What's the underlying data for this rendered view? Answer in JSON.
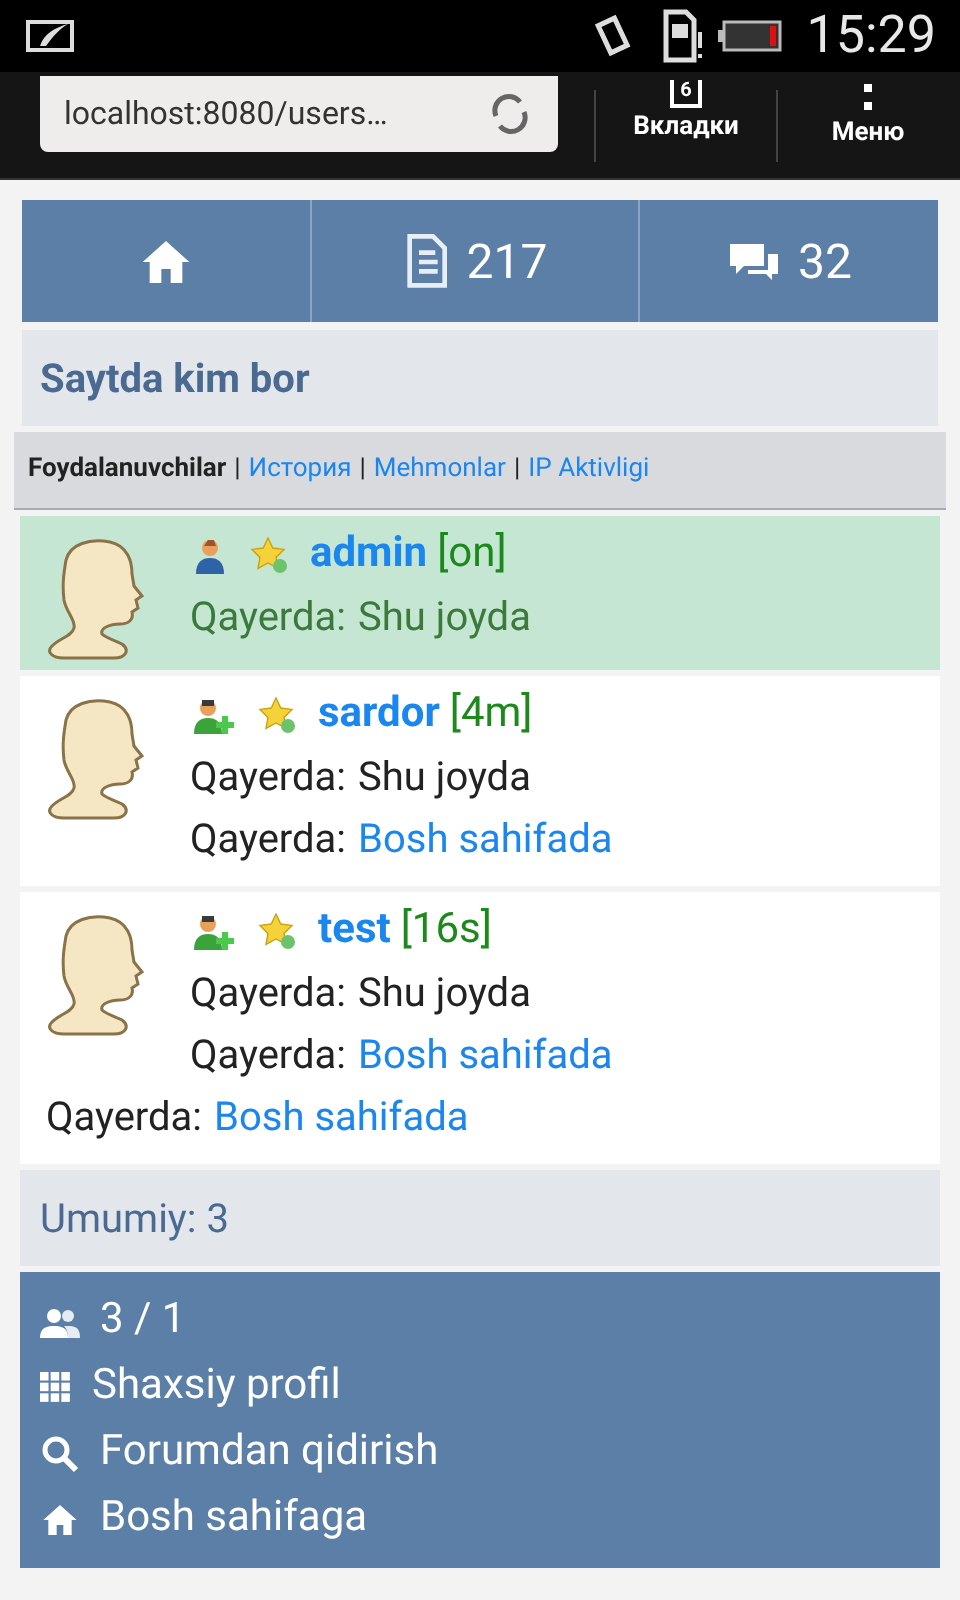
{
  "status_bar": {
    "time": "15:29"
  },
  "browser": {
    "url": "localhost:8080/users…",
    "tab_count": "6",
    "tabs_label": "Вкладки",
    "menu_label": "Меню"
  },
  "nav": [
    {
      "kind": "home"
    },
    {
      "kind": "posts",
      "count": "217"
    },
    {
      "kind": "messages",
      "count": "32"
    }
  ],
  "heading": "Saytda kim bor",
  "filters": [
    {
      "label": "Foydalanuvchilar",
      "selected": true
    },
    {
      "separator": "|",
      "label": "История",
      "selected": false
    },
    {
      "separator": "|",
      "label": "Mehmonlar",
      "selected": false
    },
    {
      "separator": "|",
      "label": "IP Aktivligi",
      "selected": false
    }
  ],
  "users": [
    {
      "name": "admin",
      "status": "[on]",
      "kind": "admin",
      "current": true,
      "places": [
        {
          "prefix": "Qayerda:",
          "value": "Shu joyda",
          "link": false
        }
      ]
    },
    {
      "name": "sardor",
      "status": "[4m]",
      "kind": "member",
      "current": false,
      "places": [
        {
          "prefix": "Qayerda:",
          "value": "Shu joyda",
          "link": false
        },
        {
          "prefix": "Qayerda:",
          "value": "Bosh sahifada",
          "link": true
        }
      ]
    },
    {
      "name": "test",
      "status": "[16s]",
      "kind": "member",
      "current": false,
      "places": [
        {
          "prefix": "Qayerda:",
          "value": "Shu joyda",
          "link": false
        },
        {
          "prefix": "Qayerda:",
          "value": "Bosh sahifada",
          "link": true
        }
      ],
      "extra_places": [
        {
          "prefix": "Qayerda:",
          "value": "Bosh sahifada",
          "link": true
        }
      ]
    }
  ],
  "total": "Umumiy: 3",
  "footer": [
    {
      "kind": "users",
      "label": "3 / 1"
    },
    {
      "kind": "grid",
      "label": "Shaxsiy profil"
    },
    {
      "kind": "search",
      "label": "Forumdan qidirish"
    },
    {
      "kind": "home",
      "label": "Bosh sahifaga"
    }
  ]
}
